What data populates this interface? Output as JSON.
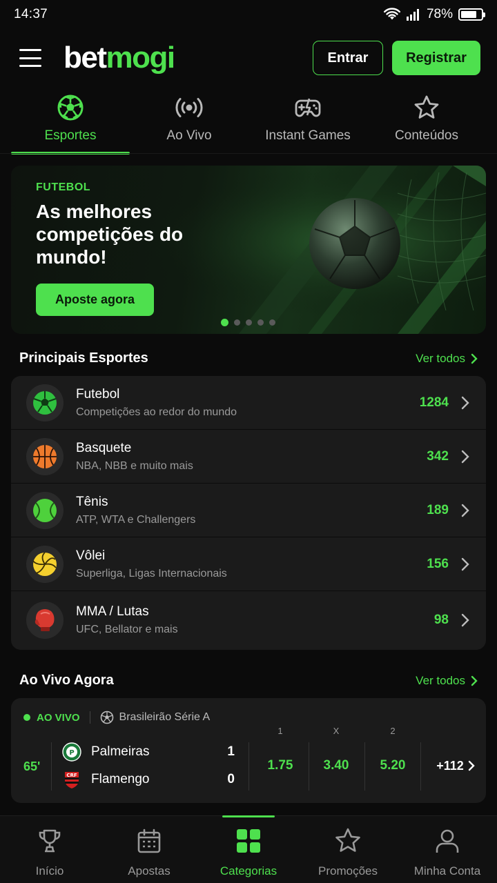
{
  "status_bar": {
    "time": "14:37",
    "battery": "78%",
    "battery_level": 0.78
  },
  "header": {
    "logo_part1": "bet",
    "logo_part2": "mogi",
    "login_label": "Entrar",
    "register_label": "Registrar"
  },
  "top_tabs": [
    {
      "label": "Esportes",
      "icon": "soccer-ball-icon",
      "active": true
    },
    {
      "label": "Ao Vivo",
      "icon": "broadcast-icon",
      "active": false
    },
    {
      "label": "Instant Games",
      "icon": "gamepad-icon",
      "active": false
    },
    {
      "label": "Conteúdos",
      "icon": "star-icon",
      "active": false
    }
  ],
  "banner": {
    "eyebrow": "FUTEBOL",
    "title": "As melhores competições do mundo!",
    "cta": "Aposte agora",
    "slides": 5,
    "active_slide": 1
  },
  "sports_section": {
    "title": "Principais Esportes",
    "see_all": "Ver todos",
    "items": [
      {
        "name": "Futebol",
        "sub": "Competições ao redor do mundo",
        "count": "1284",
        "icon": "soccer-ball-icon"
      },
      {
        "name": "Basquete",
        "sub": "NBA, NBB e muito mais",
        "count": "342",
        "icon": "basketball-icon"
      },
      {
        "name": "Tênis",
        "sub": "ATP, WTA e Challengers",
        "count": "189",
        "icon": "tennis-ball-icon"
      },
      {
        "name": "Vôlei",
        "sub": "Superliga, Ligas Internacionais",
        "count": "156",
        "icon": "volleyball-icon"
      },
      {
        "name": "MMA / Lutas",
        "sub": "UFC, Bellator e mais",
        "count": "98",
        "icon": "boxing-glove-icon"
      }
    ]
  },
  "live_section": {
    "title": "Ao Vivo Agora",
    "see_all": "Ver todos",
    "match": {
      "badge": "AO VIVO",
      "league": "Brasileirão Série A",
      "minute": "65'",
      "home": {
        "name": "Palmeiras",
        "score": "1"
      },
      "away": {
        "name": "Flamengo",
        "score": "0"
      },
      "odds_headers": [
        "1",
        "X",
        "2"
      ],
      "odds": [
        "1.75",
        "3.40",
        "5.20"
      ],
      "more": "+112"
    }
  },
  "bottom_nav": [
    {
      "label": "Início",
      "icon": "trophy-icon",
      "active": false
    },
    {
      "label": "Apostas",
      "icon": "calendar-icon",
      "active": false
    },
    {
      "label": "Categorias",
      "icon": "grid-icon",
      "active": true
    },
    {
      "label": "Promoções",
      "icon": "star-icon",
      "active": false
    },
    {
      "label": "Minha Conta",
      "icon": "user-icon",
      "active": false
    }
  ],
  "colors": {
    "accent": "#4ee04e",
    "background": "#0b0b0b",
    "card": "#1b1b1b"
  }
}
